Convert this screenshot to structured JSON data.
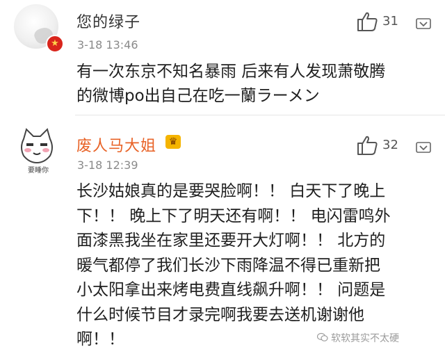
{
  "comments": [
    {
      "username": "您的绿子",
      "time": "3-18 13:46",
      "likes": "31",
      "lines": [
        "有一次东京不知名暴雨 后来有人发现萧敬腾",
        "的微博po出自己在吃一蘭ラーメン"
      ],
      "avatar_icon": "profile-photo",
      "badge_icon": "red-star-badge-icon"
    },
    {
      "username": "废人马大姐",
      "avatar_caption": "要睡你",
      "time": "3-18 12:39",
      "likes": "32",
      "lines": [
        "长沙姑娘真的是要哭脸啊！！ 白天下了晚上",
        "下！！ 晚上下了明天还有啊！！ 电闪雷鸣外",
        "面漆黑我坐在家里还要开大灯啊！！ 北方的",
        "暖气都停了我们长沙下雨降温不得已重新把",
        "小太阳拿出来烤电费直线飙升啊！！ 问题是",
        "什么时候节目才录完啊我要去送机谢谢他",
        "啊！！"
      ],
      "avatar_icon": "cartoon-cat-avatar",
      "badge_icon": "crown-icon"
    }
  ],
  "watermark": "软软其实不太硬",
  "colors": {
    "vip_name": "#e86226",
    "badge_red": "#d9251c",
    "crown": "#f5b400"
  }
}
